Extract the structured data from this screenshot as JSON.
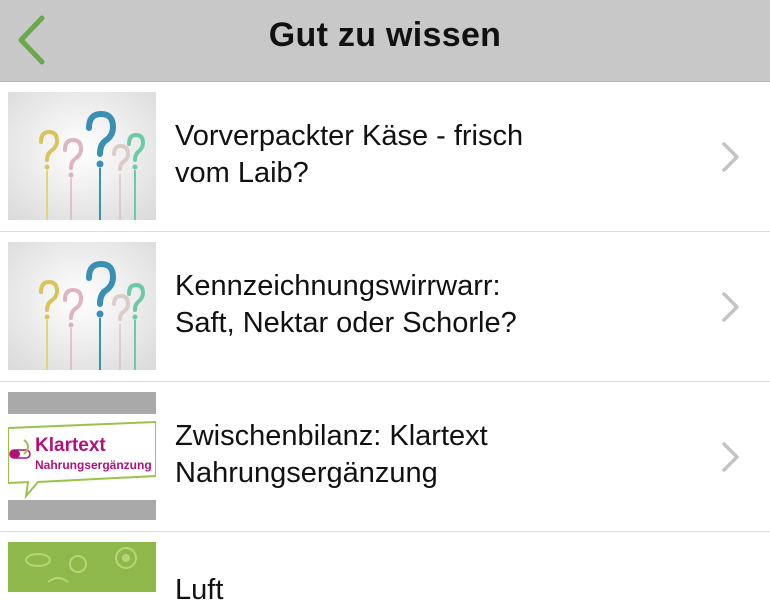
{
  "header": {
    "title": "Gut zu wissen",
    "back_icon": "chevron-left-icon",
    "accent_color": "#6aa84f",
    "background_color": "#c8c8c8"
  },
  "list": {
    "items": [
      {
        "title": "Vorverpackter Käse - frisch\nvom Laib?",
        "thumbnail": "question-marks-image"
      },
      {
        "title": "Kennzeichnungswirrwarr:\nSaft, Nektar oder Schorle?",
        "thumbnail": "question-marks-image"
      },
      {
        "title": "Zwischenbilanz: Klartext\nNahrungsergänzung",
        "thumbnail": "klartext-logo-image",
        "thumbnail_text": {
          "line1": "Klartext",
          "line2": "Nahrungsergänzung"
        }
      },
      {
        "title": "Luft",
        "thumbnail": "green-food-illustration"
      }
    ]
  },
  "icons": {
    "row_chevron": "chevron-right-icon"
  }
}
